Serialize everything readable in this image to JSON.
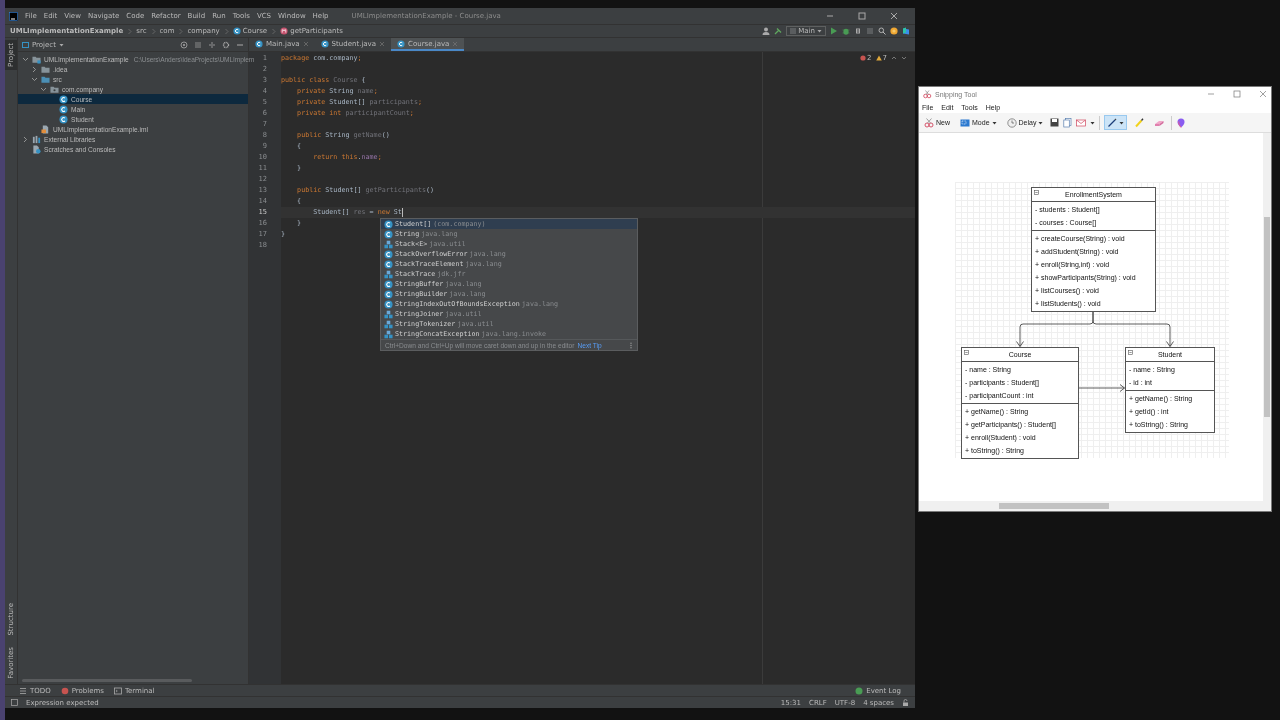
{
  "ide": {
    "menu": [
      "File",
      "Edit",
      "View",
      "Navigate",
      "Code",
      "Refactor",
      "Build",
      "Run",
      "Tools",
      "VCS",
      "Window",
      "Help"
    ],
    "title": "UMLImplementationExample - Course.java",
    "breadcrumbs": [
      {
        "label": "UMLImplementationExample",
        "kind": "path"
      },
      {
        "label": "src",
        "kind": "path"
      },
      {
        "label": "com",
        "kind": "path"
      },
      {
        "label": "company",
        "kind": "path"
      },
      {
        "label": "Course",
        "kind": "class"
      },
      {
        "label": "getParticipants",
        "kind": "method"
      }
    ],
    "run_config": "Main",
    "left_tool_tabs": {
      "top": [
        {
          "label": "Project",
          "selected": true
        }
      ],
      "bottom": [
        {
          "label": "Structure",
          "selected": false
        },
        {
          "label": "Favorites",
          "selected": false
        }
      ]
    },
    "project_view": {
      "title": "Project",
      "tree": [
        {
          "label": "UMLImplementationExample",
          "kind": "module",
          "expanded": true,
          "selected": false,
          "hint": "C:\\Users\\Anders\\IdeaProjects\\UMLImplem",
          "children": [
            {
              "label": ".idea",
              "kind": "folder",
              "expanded": false,
              "selected": false
            },
            {
              "label": "src",
              "kind": "source",
              "expanded": true,
              "selected": false,
              "children": [
                {
                  "label": "com.company",
                  "kind": "package",
                  "expanded": true,
                  "selected": false,
                  "children": [
                    {
                      "label": "Course",
                      "kind": "class",
                      "selected": true
                    },
                    {
                      "label": "Main",
                      "kind": "class",
                      "selected": false
                    },
                    {
                      "label": "Student",
                      "kind": "class",
                      "selected": false
                    }
                  ]
                }
              ]
            },
            {
              "label": "UMLImplementationExample.iml",
              "kind": "file",
              "selected": false
            }
          ]
        },
        {
          "label": "External Libraries",
          "kind": "library",
          "expanded": false,
          "selected": false
        },
        {
          "label": "Scratches and Consoles",
          "kind": "scratch",
          "selected": false
        }
      ]
    },
    "editor_tabs": [
      {
        "label": "Main.java",
        "selected": false
      },
      {
        "label": "Student.java",
        "selected": false
      },
      {
        "label": "Course.java",
        "selected": true
      }
    ],
    "inspections": {
      "errors": "2",
      "warnings": "7"
    },
    "code_lines": [
      {
        "number": "1",
        "current": false,
        "tokens": [
          {
            "text": "package ",
            "kind": "keyword"
          },
          {
            "text": "com.company",
            "kind": "plain"
          },
          {
            "text": ";",
            "kind": "keyword"
          }
        ]
      },
      {
        "number": "2",
        "current": false
      },
      {
        "number": "3",
        "current": false,
        "tokens": [
          {
            "text": "public class ",
            "kind": "keyword"
          },
          {
            "text": "Course",
            "kind": "unused"
          },
          {
            "text": " {",
            "kind": "plain"
          }
        ]
      },
      {
        "number": "4",
        "current": false,
        "tokens": [
          {
            "text": "    private ",
            "kind": "keyword"
          },
          {
            "text": "String ",
            "kind": "plain"
          },
          {
            "text": "name",
            "kind": "unused"
          },
          {
            "text": ";",
            "kind": "keyword"
          }
        ]
      },
      {
        "number": "5",
        "current": false,
        "tokens": [
          {
            "text": "    private ",
            "kind": "keyword"
          },
          {
            "text": "Student[] ",
            "kind": "plain"
          },
          {
            "text": "participants",
            "kind": "unused"
          },
          {
            "text": ";",
            "kind": "keyword"
          }
        ]
      },
      {
        "number": "6",
        "current": false,
        "tokens": [
          {
            "text": "    private int ",
            "kind": "keyword"
          },
          {
            "text": "participantCount",
            "kind": "unused"
          },
          {
            "text": ";",
            "kind": "keyword"
          }
        ]
      },
      {
        "number": "7",
        "current": false
      },
      {
        "number": "8",
        "current": false,
        "tokens": [
          {
            "text": "    public ",
            "kind": "keyword"
          },
          {
            "text": "String ",
            "kind": "plain"
          },
          {
            "text": "getName",
            "kind": "unused"
          },
          {
            "text": "()",
            "kind": "plain"
          }
        ]
      },
      {
        "number": "9",
        "current": false,
        "tokens": [
          {
            "text": "    {",
            "kind": "plain"
          }
        ]
      },
      {
        "number": "10",
        "current": false,
        "tokens": [
          {
            "text": "        return this",
            "kind": "keyword"
          },
          {
            "text": ".",
            "kind": "plain"
          },
          {
            "text": "name",
            "kind": "field"
          },
          {
            "text": ";",
            "kind": "keyword"
          }
        ]
      },
      {
        "number": "11",
        "current": false,
        "tokens": [
          {
            "text": "    }",
            "kind": "plain"
          }
        ]
      },
      {
        "number": "12",
        "current": false
      },
      {
        "number": "13",
        "current": false,
        "tokens": [
          {
            "text": "    public ",
            "kind": "keyword"
          },
          {
            "text": "Student[] ",
            "kind": "plain"
          },
          {
            "text": "getParticipants",
            "kind": "unused"
          },
          {
            "text": "()",
            "kind": "plain"
          }
        ]
      },
      {
        "number": "14",
        "current": false,
        "tokens": [
          {
            "text": "    {",
            "kind": "plain"
          }
        ]
      },
      {
        "number": "15",
        "current": true,
        "tokens": [
          {
            "text": "        Student[] ",
            "kind": "plain"
          },
          {
            "text": "res",
            "kind": "unused"
          },
          {
            "text": " = ",
            "kind": "plain"
          },
          {
            "text": "new ",
            "kind": "keyword"
          },
          {
            "text": "St",
            "kind": "plain"
          }
        ]
      },
      {
        "number": "16",
        "current": false,
        "tokens": [
          {
            "text": "    }",
            "kind": "plain"
          }
        ]
      },
      {
        "number": "17",
        "current": false,
        "tokens": [
          {
            "text": "}",
            "kind": "plain"
          }
        ]
      },
      {
        "number": "18",
        "current": false
      }
    ],
    "completion": {
      "items": [
        {
          "name": "Student[]",
          "detail": "(com.company)",
          "kind": "class",
          "selected": true
        },
        {
          "name": "String",
          "detail": "java.lang",
          "kind": "class",
          "selected": false
        },
        {
          "name": "Stack<E>",
          "detail": "java.util",
          "kind": "api",
          "selected": false
        },
        {
          "name": "StackOverflowError",
          "detail": "java.lang",
          "kind": "class",
          "selected": false
        },
        {
          "name": "StackTraceElement",
          "detail": "java.lang",
          "kind": "class",
          "selected": false
        },
        {
          "name": "StackTrace",
          "detail": "jdk.jfr",
          "kind": "api",
          "selected": false
        },
        {
          "name": "StringBuffer",
          "detail": "java.lang",
          "kind": "class",
          "selected": false
        },
        {
          "name": "StringBuilder",
          "detail": "java.lang",
          "kind": "class",
          "selected": false
        },
        {
          "name": "StringIndexOutOfBoundsException",
          "detail": "java.lang",
          "kind": "class",
          "selected": false
        },
        {
          "name": "StringJoiner",
          "detail": "java.util",
          "kind": "api",
          "selected": false
        },
        {
          "name": "StringTokenizer",
          "detail": "java.util",
          "kind": "api",
          "selected": false
        },
        {
          "name": "StringConcatException",
          "detail": "java.lang.invoke",
          "kind": "api",
          "selected": false
        }
      ],
      "hint": "Ctrl+Down and Ctrl+Up will move caret down and up in the editor",
      "link": "Next Tip"
    },
    "tool_windows": [
      {
        "label": "TODO",
        "kind": "todo"
      },
      {
        "label": "Problems",
        "kind": "problems"
      },
      {
        "label": "Terminal",
        "kind": "terminal"
      }
    ],
    "event_log": "Event Log",
    "status": {
      "message": "Expression expected",
      "items": [
        "15:31",
        "CRLF",
        "UTF-8",
        "4 spaces"
      ]
    }
  },
  "snipping_tool": {
    "title": "Snipping Tool",
    "menu": [
      "File",
      "Edit",
      "Tools",
      "Help"
    ],
    "buttons": [
      {
        "label": "New",
        "kind": "new"
      },
      {
        "label": "Mode",
        "kind": "mode"
      },
      {
        "label": "Delay",
        "kind": "delay"
      }
    ],
    "tools": [
      {
        "kind": "pen",
        "selected": true
      },
      {
        "kind": "highlighter",
        "selected": false
      },
      {
        "kind": "eraser",
        "selected": false
      }
    ],
    "diagram": {
      "classes": [
        {
          "name": "EnrollmentSystem",
          "attributes": [
            "- students : Student[]",
            "- courses : Course[]"
          ],
          "methods": [
            "+ createCourse(String) : void",
            "+ addStudent(String) : void",
            "+ enroll(String,int) : void",
            "+ showParticipants(String) : void",
            "+ listCourses() : void",
            "+ listStudents() : void"
          ]
        },
        {
          "name": "Course",
          "attributes": [
            "- name : String",
            "- participants : Student[]",
            "- participantCount : int"
          ],
          "methods": [
            "+ getName() : String",
            "+ getParticipants() : Student[]",
            "+ enroll(Student) : void",
            "+ toString() : String"
          ]
        },
        {
          "name": "Student",
          "attributes": [
            "- name : String",
            "- id : int"
          ],
          "methods": [
            "+ getName() : String",
            "+ getId() : int",
            "+ toString() : String"
          ]
        }
      ]
    }
  }
}
